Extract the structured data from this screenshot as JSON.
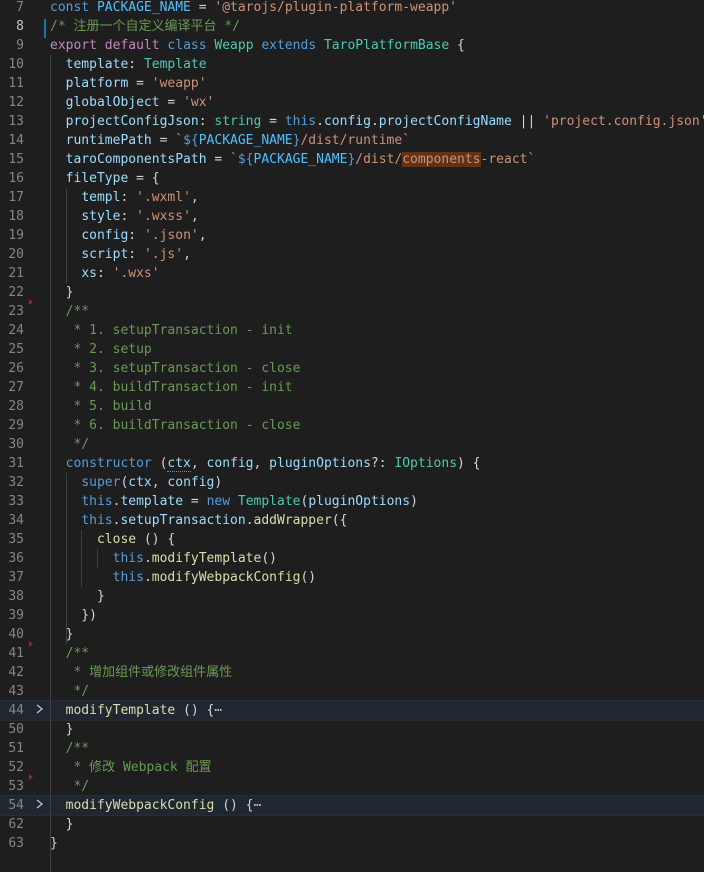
{
  "editor": {
    "lines": [
      {
        "n": "7",
        "tokens": [
          [
            "kw",
            "const "
          ],
          [
            "const",
            "PACKAGE_NAME"
          ],
          [
            "punc",
            " = "
          ],
          [
            "str",
            "'@tarojs/plugin-platform-weapp'"
          ]
        ]
      },
      {
        "n": "8",
        "active": true,
        "tokens": [
          [
            "cmt",
            "/* 注册一个自定义编译平台 */"
          ]
        ]
      },
      {
        "n": "9",
        "tokens": [
          [
            "kw2",
            "export "
          ],
          [
            "kw2",
            "default "
          ],
          [
            "kw",
            "class "
          ],
          [
            "type",
            "Weapp "
          ],
          [
            "kw",
            "extends "
          ],
          [
            "type",
            "TaroPlatformBase "
          ],
          [
            "punc",
            "{"
          ]
        ]
      },
      {
        "n": "10",
        "tokens": [
          [
            "punc",
            "  "
          ],
          [
            "var",
            "template"
          ],
          [
            "punc",
            ": "
          ],
          [
            "type",
            "Template"
          ]
        ]
      },
      {
        "n": "11",
        "tokens": [
          [
            "punc",
            "  "
          ],
          [
            "var",
            "platform"
          ],
          [
            "punc",
            " = "
          ],
          [
            "str",
            "'weapp'"
          ]
        ]
      },
      {
        "n": "12",
        "tokens": [
          [
            "punc",
            "  "
          ],
          [
            "var",
            "globalObject"
          ],
          [
            "punc",
            " = "
          ],
          [
            "str",
            "'wx'"
          ]
        ]
      },
      {
        "n": "13",
        "tokens": [
          [
            "punc",
            "  "
          ],
          [
            "var",
            "projectConfigJson"
          ],
          [
            "punc",
            ": "
          ],
          [
            "type",
            "string"
          ],
          [
            "punc",
            " = "
          ],
          [
            "kw",
            "this"
          ],
          [
            "punc",
            "."
          ],
          [
            "var",
            "config"
          ],
          [
            "punc",
            "."
          ],
          [
            "var",
            "projectConfigName"
          ],
          [
            "punc",
            " || "
          ],
          [
            "str",
            "'project.config.json'"
          ]
        ]
      },
      {
        "n": "14",
        "tokens": [
          [
            "punc",
            "  "
          ],
          [
            "var",
            "runtimePath"
          ],
          [
            "punc",
            " = "
          ],
          [
            "str",
            "`"
          ],
          [
            "tmpl",
            "${"
          ],
          [
            "const",
            "PACKAGE_NAME"
          ],
          [
            "tmpl",
            "}"
          ],
          [
            "str",
            "/dist/runtime`"
          ]
        ]
      },
      {
        "n": "15",
        "tokens": [
          [
            "punc",
            "  "
          ],
          [
            "var",
            "taroComponentsPath"
          ],
          [
            "punc",
            " = "
          ],
          [
            "str",
            "`"
          ],
          [
            "tmpl",
            "${"
          ],
          [
            "const",
            "PACKAGE_NAME"
          ],
          [
            "tmpl",
            "}"
          ],
          [
            "str",
            "/dist/"
          ],
          [
            "str match",
            "components"
          ],
          [
            "str",
            "-react`"
          ]
        ]
      },
      {
        "n": "16",
        "tokens": [
          [
            "punc",
            "  "
          ],
          [
            "var",
            "fileType"
          ],
          [
            "punc",
            " = {"
          ]
        ]
      },
      {
        "n": "17",
        "tokens": [
          [
            "punc",
            "    "
          ],
          [
            "var",
            "templ"
          ],
          [
            "punc",
            ": "
          ],
          [
            "str",
            "'.wxml'"
          ],
          [
            "punc",
            ","
          ]
        ]
      },
      {
        "n": "18",
        "tokens": [
          [
            "punc",
            "    "
          ],
          [
            "var",
            "style"
          ],
          [
            "punc",
            ": "
          ],
          [
            "str",
            "'.wxss'"
          ],
          [
            "punc",
            ","
          ]
        ]
      },
      {
        "n": "19",
        "tokens": [
          [
            "punc",
            "    "
          ],
          [
            "var",
            "config"
          ],
          [
            "punc",
            ": "
          ],
          [
            "str",
            "'.json'"
          ],
          [
            "punc",
            ","
          ]
        ]
      },
      {
        "n": "20",
        "tokens": [
          [
            "punc",
            "    "
          ],
          [
            "var",
            "script"
          ],
          [
            "punc",
            ": "
          ],
          [
            "str",
            "'.js'"
          ],
          [
            "punc",
            ","
          ]
        ]
      },
      {
        "n": "21",
        "tokens": [
          [
            "punc",
            "    "
          ],
          [
            "var",
            "xs"
          ],
          [
            "punc",
            ": "
          ],
          [
            "str",
            "'.wxs'"
          ]
        ]
      },
      {
        "n": "22",
        "tokens": [
          [
            "punc",
            "  }"
          ]
        ]
      },
      {
        "n": "23",
        "tokens": [
          [
            "punc",
            "  "
          ],
          [
            "cmt",
            "/**"
          ]
        ]
      },
      {
        "n": "24",
        "tokens": [
          [
            "punc",
            "  "
          ],
          [
            "cmt",
            " * 1. setupTransaction - init"
          ]
        ]
      },
      {
        "n": "25",
        "tokens": [
          [
            "punc",
            "  "
          ],
          [
            "cmt",
            " * 2. setup"
          ]
        ]
      },
      {
        "n": "26",
        "tokens": [
          [
            "punc",
            "  "
          ],
          [
            "cmt",
            " * 3. setupTransaction - close"
          ]
        ]
      },
      {
        "n": "27",
        "tokens": [
          [
            "punc",
            "  "
          ],
          [
            "cmt",
            " * 4. buildTransaction - init"
          ]
        ]
      },
      {
        "n": "28",
        "tokens": [
          [
            "punc",
            "  "
          ],
          [
            "cmt",
            " * 5. build"
          ]
        ]
      },
      {
        "n": "29",
        "tokens": [
          [
            "punc",
            "  "
          ],
          [
            "cmt",
            " * 6. buildTransaction - close"
          ]
        ]
      },
      {
        "n": "30",
        "tokens": [
          [
            "punc",
            "  "
          ],
          [
            "cmt",
            " */"
          ]
        ]
      },
      {
        "n": "31",
        "tokens": [
          [
            "punc",
            "  "
          ],
          [
            "kw",
            "constructor"
          ],
          [
            "punc",
            " ("
          ],
          [
            "var dotted",
            "ctx"
          ],
          [
            "punc",
            ", "
          ],
          [
            "var",
            "config"
          ],
          [
            "punc",
            ", "
          ],
          [
            "var",
            "pluginOptions"
          ],
          [
            "punc",
            "?: "
          ],
          [
            "type",
            "IOptions"
          ],
          [
            "punc",
            ") {"
          ]
        ]
      },
      {
        "n": "32",
        "tokens": [
          [
            "punc",
            "    "
          ],
          [
            "kw",
            "super"
          ],
          [
            "punc",
            "("
          ],
          [
            "var",
            "ctx"
          ],
          [
            "punc",
            ", "
          ],
          [
            "var",
            "config"
          ],
          [
            "punc",
            ")"
          ]
        ]
      },
      {
        "n": "33",
        "tokens": [
          [
            "punc",
            "    "
          ],
          [
            "kw",
            "this"
          ],
          [
            "punc",
            "."
          ],
          [
            "var",
            "template"
          ],
          [
            "punc",
            " = "
          ],
          [
            "kw",
            "new "
          ],
          [
            "type",
            "Template"
          ],
          [
            "punc",
            "("
          ],
          [
            "var",
            "pluginOptions"
          ],
          [
            "punc",
            ")"
          ]
        ]
      },
      {
        "n": "34",
        "tokens": [
          [
            "punc",
            "    "
          ],
          [
            "kw",
            "this"
          ],
          [
            "punc",
            "."
          ],
          [
            "var",
            "setupTransaction"
          ],
          [
            "punc",
            "."
          ],
          [
            "fn",
            "addWrapper"
          ],
          [
            "punc",
            "({"
          ]
        ]
      },
      {
        "n": "35",
        "tokens": [
          [
            "punc",
            "      "
          ],
          [
            "fn",
            "close"
          ],
          [
            "punc",
            " () {"
          ]
        ]
      },
      {
        "n": "36",
        "tokens": [
          [
            "punc",
            "        "
          ],
          [
            "kw",
            "this"
          ],
          [
            "punc",
            "."
          ],
          [
            "fn",
            "modifyTemplate"
          ],
          [
            "punc",
            "()"
          ]
        ]
      },
      {
        "n": "37",
        "tokens": [
          [
            "punc",
            "        "
          ],
          [
            "kw",
            "this"
          ],
          [
            "punc",
            "."
          ],
          [
            "fn",
            "modifyWebpackConfig"
          ],
          [
            "punc",
            "()"
          ]
        ]
      },
      {
        "n": "38",
        "tokens": [
          [
            "punc",
            "      }"
          ]
        ]
      },
      {
        "n": "39",
        "tokens": [
          [
            "punc",
            "    })"
          ]
        ]
      },
      {
        "n": "40",
        "tokens": [
          [
            "punc",
            "  }"
          ]
        ]
      },
      {
        "n": "41",
        "tokens": [
          [
            "punc",
            "  "
          ],
          [
            "cmt",
            "/**"
          ]
        ]
      },
      {
        "n": "42",
        "tokens": [
          [
            "punc",
            "  "
          ],
          [
            "cmt",
            " * 增加组件或修改组件属性"
          ]
        ]
      },
      {
        "n": "43",
        "tokens": [
          [
            "punc",
            "  "
          ],
          [
            "cmt",
            " */"
          ]
        ]
      },
      {
        "n": "44",
        "folded": true,
        "tokens": [
          [
            "punc",
            "  "
          ],
          [
            "fn",
            "modifyTemplate"
          ],
          [
            "punc",
            " () {"
          ],
          [
            "ellipsis",
            "⋯"
          ]
        ]
      },
      {
        "n": "50",
        "tokens": [
          [
            "punc",
            "  }"
          ]
        ]
      },
      {
        "n": "51",
        "tokens": [
          [
            "punc",
            "  "
          ],
          [
            "cmt",
            "/**"
          ]
        ]
      },
      {
        "n": "52",
        "tokens": [
          [
            "punc",
            "  "
          ],
          [
            "cmt",
            " * 修改 Webpack 配置"
          ]
        ]
      },
      {
        "n": "53",
        "tokens": [
          [
            "punc",
            "  "
          ],
          [
            "cmt",
            " */"
          ]
        ]
      },
      {
        "n": "54",
        "folded": true,
        "tokens": [
          [
            "punc",
            "  "
          ],
          [
            "fn",
            "modifyWebpackConfig"
          ],
          [
            "punc",
            " () {"
          ],
          [
            "ellipsis",
            "⋯"
          ]
        ]
      },
      {
        "n": "62",
        "tokens": [
          [
            "punc",
            "  }"
          ]
        ]
      },
      {
        "n": "63",
        "tokens": [
          [
            "punc",
            "}"
          ]
        ]
      }
    ]
  },
  "icons": {
    "fold_closed": "chevron-right-icon"
  }
}
